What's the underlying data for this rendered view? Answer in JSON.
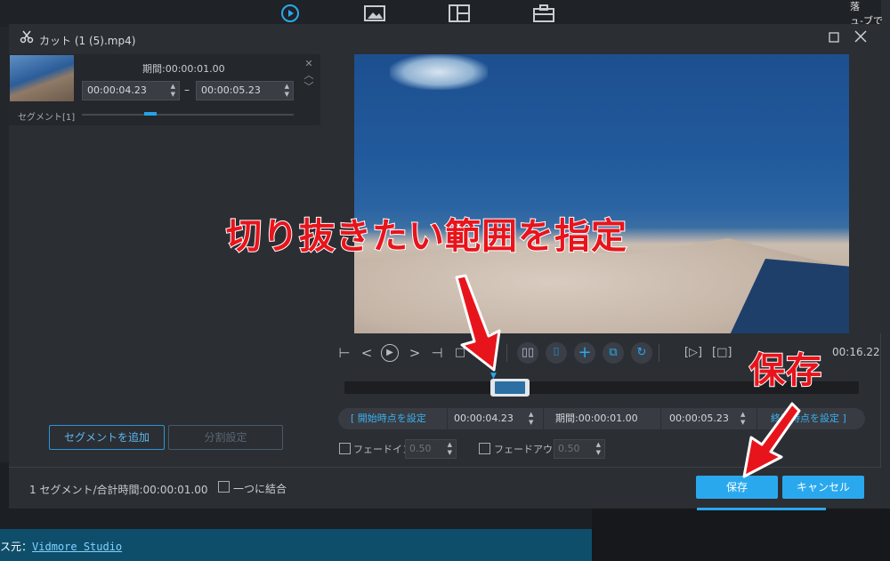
{
  "background": {
    "right_text": "落\nュ-ブで",
    "bottom_label": "ス元：",
    "bottom_link": "Vidmore Studio"
  },
  "dialog": {
    "title": "カット (1 (5).mp4)",
    "icons": {
      "cut": "scissors-icon",
      "maximize": "maximize-icon",
      "close": "close-icon"
    }
  },
  "segment": {
    "label": "セグメント[1]",
    "duration_label": "期間:00:00:01.00",
    "start": "00:00:04.23",
    "end": "00:00:05.23",
    "separator": "–"
  },
  "left_buttons": {
    "add_segment": "セグメントを追加",
    "split_settings": "分割設定"
  },
  "player": {
    "timecode": "00:16.22",
    "clip_time_start": "00:00:04.23",
    "clip_duration": "期間:00:00:01.00",
    "clip_time_end": "00:00:05.23",
    "set_start": "[ 開始時点を設定",
    "set_end": "終了時点を設定 ]"
  },
  "fade": {
    "fade_in_label": "フェードイン",
    "fade_in_value": "0.50",
    "fade_out_label": "フェードアウト",
    "fade_out_value": "0.50"
  },
  "footer": {
    "summary": "1 セグメント/合計時間:00:00:01.00",
    "merge_label": "一つに結合",
    "save": "保存",
    "cancel": "キャンセル"
  },
  "annotations": {
    "range_caption": "切り抜きたい範囲を指定",
    "save_caption": "保存",
    "color": "#e8141c"
  }
}
